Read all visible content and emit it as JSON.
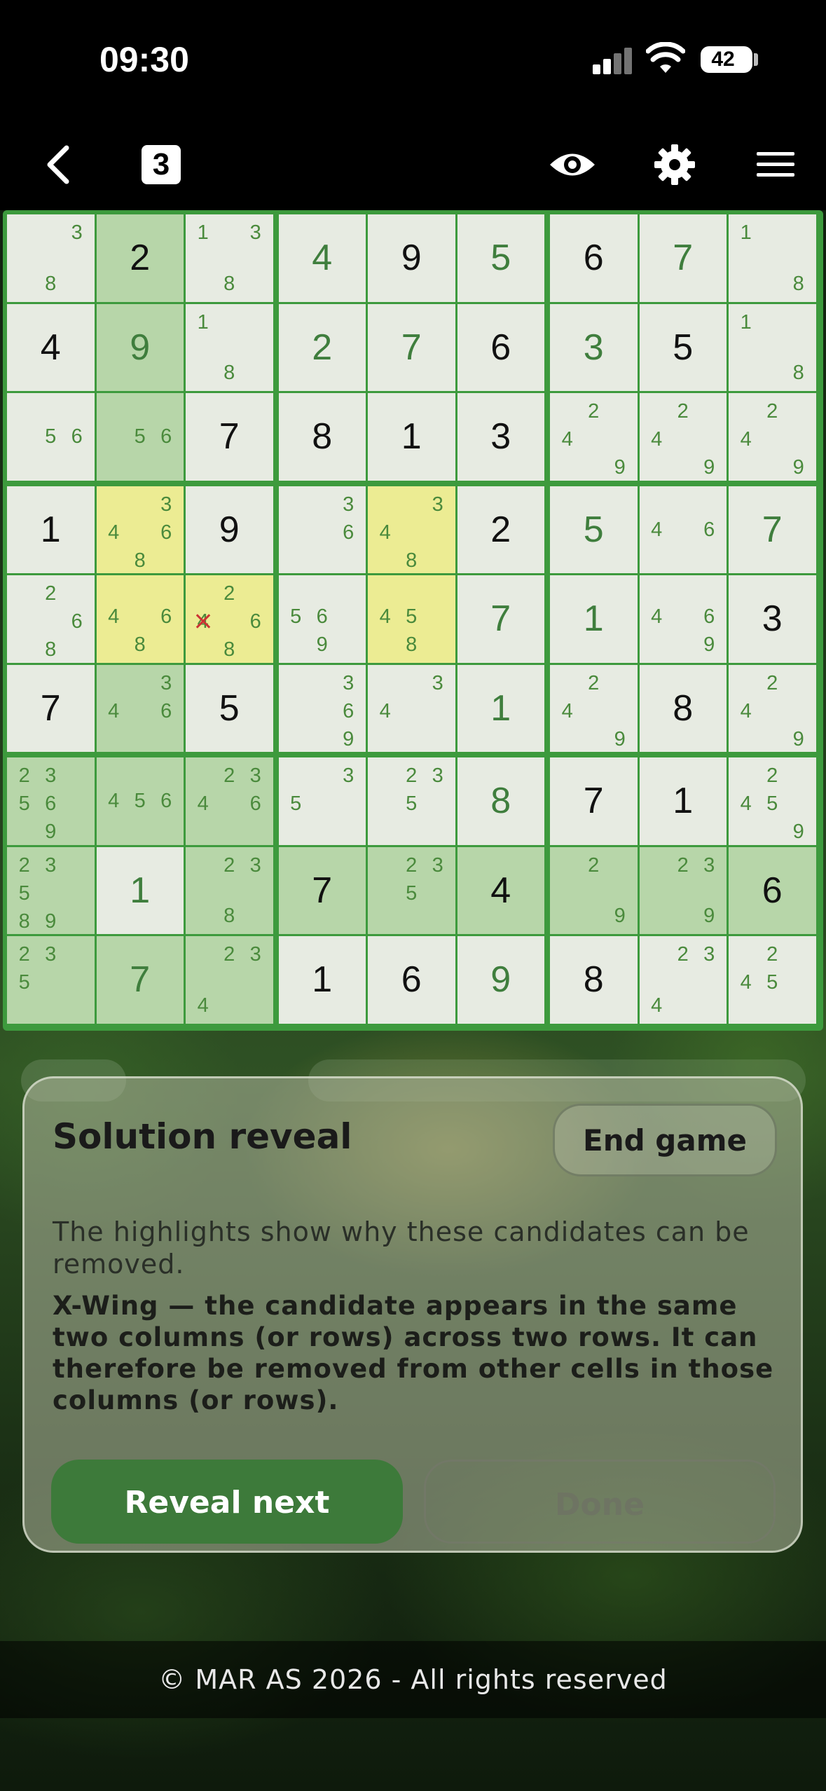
{
  "status_bar": {
    "time": "09:30",
    "battery": "42"
  },
  "toolbar": {
    "back_icon": "chevron-left-icon",
    "level_badge": "3",
    "eye_icon": "eye-icon",
    "settings_icon": "gear-icon",
    "menu_icon": "hamburger-menu-icon"
  },
  "colors": {
    "board_border": "#3d9a3d",
    "cell_light": "#e7ebe2",
    "cell_green": "#b7d6a9",
    "cell_yellow": "#ecec93",
    "given_digit": "#111111",
    "filled_digit": "#3f7e3d",
    "candidate": "#4a8a3c",
    "removed_mark": "#cc3333",
    "reveal_button": "#3d7a3a"
  },
  "board": [
    [
      {
        "c": [
          "3",
          "8"
        ],
        "ci": [
          2,
          7
        ]
      },
      {
        "v": "2",
        "g": 1,
        "h": "green"
      },
      {
        "c": [
          "1",
          "3",
          "8"
        ],
        "ci": [
          0,
          2,
          7
        ]
      },
      {
        "v": "4",
        "g": 0
      },
      {
        "v": "9",
        "g": 1
      },
      {
        "v": "5",
        "g": 0
      },
      {
        "v": "6",
        "g": 1
      },
      {
        "v": "7",
        "g": 0
      },
      {
        "c": [
          "1",
          "8"
        ],
        "ci": [
          0,
          8
        ]
      }
    ],
    [
      {
        "v": "4",
        "g": 1
      },
      {
        "v": "9",
        "g": 0,
        "h": "green"
      },
      {
        "c": [
          "1",
          "8"
        ],
        "ci": [
          0,
          7
        ]
      },
      {
        "v": "2",
        "g": 0
      },
      {
        "v": "7",
        "g": 0
      },
      {
        "v": "6",
        "g": 1
      },
      {
        "v": "3",
        "g": 0
      },
      {
        "v": "5",
        "g": 1
      },
      {
        "c": [
          "1",
          "8"
        ],
        "ci": [
          0,
          8
        ]
      }
    ],
    [
      {
        "c": [
          "5",
          "6"
        ],
        "ci": [
          4,
          5
        ]
      },
      {
        "c": [
          "5",
          "6"
        ],
        "ci": [
          4,
          5
        ],
        "h": "green"
      },
      {
        "v": "7",
        "g": 1
      },
      {
        "v": "8",
        "g": 1
      },
      {
        "v": "1",
        "g": 1
      },
      {
        "v": "3",
        "g": 1
      },
      {
        "c": [
          "2",
          "4",
          "9"
        ],
        "ci": [
          1,
          3,
          8
        ]
      },
      {
        "c": [
          "2",
          "4",
          "9"
        ],
        "ci": [
          1,
          3,
          8
        ]
      },
      {
        "c": [
          "2",
          "4",
          "9"
        ],
        "ci": [
          1,
          3,
          8
        ]
      }
    ],
    [
      {
        "v": "1",
        "g": 1
      },
      {
        "c": [
          "3",
          "4",
          "6",
          "8"
        ],
        "ci": [
          2,
          3,
          5,
          7
        ],
        "h": "yellow"
      },
      {
        "v": "9",
        "g": 1
      },
      {
        "c": [
          "3",
          "6"
        ],
        "ci": [
          2,
          5
        ]
      },
      {
        "c": [
          "3",
          "4",
          "8"
        ],
        "ci": [
          2,
          3,
          7
        ],
        "h": "yellow"
      },
      {
        "v": "2",
        "g": 1
      },
      {
        "v": "5",
        "g": 0
      },
      {
        "c": [
          "4",
          "6"
        ],
        "ci": [
          3,
          5
        ]
      },
      {
        "v": "7",
        "g": 0
      }
    ],
    [
      {
        "c": [
          "2",
          "6",
          "8"
        ],
        "ci": [
          1,
          5,
          7
        ],
        "x": [
          2
        ]
      },
      {
        "c": [
          "4",
          "6",
          "8"
        ],
        "ci": [
          3,
          5,
          7
        ],
        "h": "yellow"
      },
      {
        "c": [
          "2",
          "4",
          "6",
          "8"
        ],
        "ci": [
          1,
          3,
          5,
          7
        ],
        "x": [
          3
        ],
        "h": "yellow"
      },
      {
        "c": [
          "5",
          "6",
          "9"
        ],
        "ci": [
          3,
          4,
          7
        ]
      },
      {
        "c": [
          "4",
          "5",
          "8"
        ],
        "ci": [
          3,
          4,
          7
        ],
        "h": "yellow"
      },
      {
        "v": "7",
        "g": 0
      },
      {
        "v": "1",
        "g": 0
      },
      {
        "c": [
          "4",
          "6",
          "9"
        ],
        "ci": [
          3,
          5,
          8
        ]
      },
      {
        "v": "3",
        "g": 1
      }
    ],
    [
      {
        "v": "7",
        "g": 1
      },
      {
        "c": [
          "3",
          "4",
          "6"
        ],
        "ci": [
          2,
          3,
          5
        ],
        "h": "green"
      },
      {
        "v": "5",
        "g": 1
      },
      {
        "c": [
          "3",
          "6",
          "9"
        ],
        "ci": [
          2,
          5,
          8
        ]
      },
      {
        "c": [
          "3",
          "4"
        ],
        "ci": [
          2,
          3
        ]
      },
      {
        "v": "1",
        "g": 0
      },
      {
        "c": [
          "2",
          "4",
          "9"
        ],
        "ci": [
          1,
          3,
          8
        ]
      },
      {
        "v": "8",
        "g": 1
      },
      {
        "c": [
          "2",
          "4",
          "9"
        ],
        "ci": [
          1,
          3,
          8
        ]
      }
    ],
    [
      {
        "c": [
          "2",
          "3",
          "5",
          "6",
          "9"
        ],
        "ci": [
          0,
          1,
          3,
          4,
          7
        ],
        "h": "green"
      },
      {
        "c": [
          "4",
          "5",
          "6"
        ],
        "ci": [
          3,
          4,
          5
        ],
        "h": "green"
      },
      {
        "c": [
          "2",
          "3",
          "4",
          "6"
        ],
        "ci": [
          1,
          2,
          3,
          5
        ],
        "h": "green"
      },
      {
        "c": [
          "3",
          "5"
        ],
        "ci": [
          2,
          3
        ]
      },
      {
        "c": [
          "2",
          "3",
          "5"
        ],
        "ci": [
          1,
          2,
          4
        ]
      },
      {
        "v": "8",
        "g": 0
      },
      {
        "v": "7",
        "g": 1
      },
      {
        "v": "1",
        "g": 1
      },
      {
        "c": [
          "2",
          "4",
          "5",
          "9"
        ],
        "ci": [
          1,
          3,
          4,
          8
        ]
      }
    ],
    [
      {
        "c": [
          "2",
          "3",
          "5",
          "8",
          "9"
        ],
        "ci": [
          0,
          1,
          3,
          6,
          7
        ],
        "h": "green"
      },
      {
        "v": "1",
        "g": 0
      },
      {
        "c": [
          "2",
          "3",
          "8"
        ],
        "ci": [
          1,
          2,
          7
        ],
        "h": "green"
      },
      {
        "v": "7",
        "g": 1,
        "h": "green"
      },
      {
        "c": [
          "2",
          "3",
          "5"
        ],
        "ci": [
          1,
          2,
          4
        ],
        "h": "green"
      },
      {
        "v": "4",
        "g": 1,
        "h": "green"
      },
      {
        "c": [
          "2",
          "9"
        ],
        "ci": [
          1,
          8
        ],
        "h": "green"
      },
      {
        "c": [
          "2",
          "3",
          "9"
        ],
        "ci": [
          1,
          2,
          8
        ],
        "h": "green"
      },
      {
        "v": "6",
        "g": 1,
        "h": "green"
      }
    ],
    [
      {
        "c": [
          "2",
          "3",
          "5"
        ],
        "ci": [
          0,
          1,
          3
        ],
        "h": "green"
      },
      {
        "v": "7",
        "g": 0,
        "h": "green"
      },
      {
        "c": [
          "2",
          "3",
          "4"
        ],
        "ci": [
          1,
          2,
          6
        ],
        "h": "green"
      },
      {
        "v": "1",
        "g": 1
      },
      {
        "v": "6",
        "g": 1
      },
      {
        "v": "9",
        "g": 0
      },
      {
        "v": "8",
        "g": 1
      },
      {
        "c": [
          "2",
          "3",
          "4"
        ],
        "ci": [
          1,
          2,
          6
        ]
      },
      {
        "c": [
          "2",
          "4",
          "5"
        ],
        "ci": [
          1,
          3,
          4
        ]
      }
    ]
  ],
  "panel": {
    "title": "Solution reveal",
    "end_game_label": "End game",
    "description": "The highlights show why these candidates can be removed.",
    "explanation": "X-Wing — the candidate appears in the same two columns (or rows) across two rows. It can therefore be removed from other cells in those columns (or rows).",
    "reveal_next_label": "Reveal next",
    "done_label": "Done"
  },
  "footer": {
    "copyright": "© MAR AS 2026 - All rights reserved"
  }
}
